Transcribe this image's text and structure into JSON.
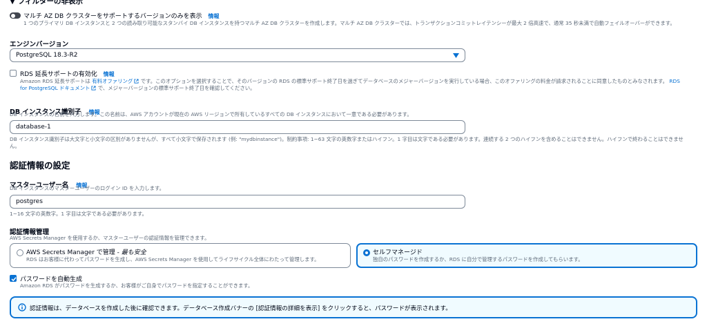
{
  "filter_section": {
    "title": "▼ フィルターの非表示",
    "toggle_label": "マルチ AZ DB クラスターをサポートするバージョンのみを表示",
    "info": "情報",
    "toggle_desc": "1 つのプライマリ DB インスタンスと 2 つの読み取り可能なスタンバイ DB インスタンスを持つマルチ AZ DB クラスターを作成します。マルチ AZ DB クラスターでは、トランザクションコミットレイテンシーが最大 2 倍高速で、通常 35 秒未満で自動フェイルオーバーができます。"
  },
  "engine_version": {
    "label": "エンジンバージョン",
    "value": "PostgreSQL 18.3-R2"
  },
  "extended_support": {
    "label": "RDS 延長サポートの有効化",
    "info": "情報",
    "desc_part1": "Amazon RDS 延長サポートは",
    "link1": "有料オファリング",
    "desc_part2": "です。このオプションを選択することで、そのバージョンの RDS の標準サポート終了日を過ぎてデータベースのメジャーバージョンを実行している場合、このオファリングの料金が請求されることに同意したものとみなされます。",
    "link2a": "RDS",
    "link2b": "for PostgreSQL ドキュメント",
    "desc_part3": "で、メジャーバージョンの標準サポート終了日を確認してください。"
  },
  "db_identifier": {
    "label": "DB インスタンス識別子",
    "info": "情報",
    "desc": "DB インスタンスの名前を入力します。この名前は、AWS アカウントが現在の AWS リージョンで所有しているすべての DB インスタンスにおいて一意である必要があります。",
    "value": "database-1",
    "constraint": "DB インスタンス識別子は大文字と小文字の区別がありませんが、すべて小文字で保存されます (例: \"mydbinstance\")。制約事項: 1~63 文字の英数字またはハイフン。1 字目は文字である必要があります。連続する 2 つのハイフンを含めることはできません。ハイフンで終わることはできませ",
    "constraint_cont": "ん。"
  },
  "credentials": {
    "heading": "認証情報の設定",
    "master_label": "マスターユーザー名",
    "info": "情報",
    "master_desc": "DB インスタンスのマスターユーザーのログイン ID を入力します。",
    "master_value": "postgres",
    "master_constraint": "1~16 文字の英数字。1 字目は文字である必要があります。",
    "mgmt_label": "認証情報管理",
    "mgmt_desc": "AWS Secrets Manager を使用するか、マスターユーザーの認証情報を管理できます。",
    "option1_title": "AWS Secrets Manager で管理 - ",
    "option1_title_em": "最も安全",
    "option1_desc": "RDS はお客様に代わってパスワードを生成し、AWS Secrets Manager を使用してライフサイクル全体にわたって管理します。",
    "option2_title": "セルフマネージド",
    "option2_desc": "独自のパスワードを作成するか、RDS に自分で管理するパスワードを作成してもらいます。",
    "autogen_label": "パスワードを自動生成",
    "autogen_desc": "Amazon RDS がパスワードを生成するか、お客様がご自身でパスワードを指定することができます。",
    "alert_text": "認証情報は、データベースを作成した後に確認できます。データベース作成バナーの [認証情報の詳細を表示] をクリックすると、パスワードが表示されます。"
  },
  "colors": {
    "accent": "#0972d3",
    "info_bg": "#f0fbff",
    "text": "#000716",
    "muted": "#5f6b7a"
  }
}
